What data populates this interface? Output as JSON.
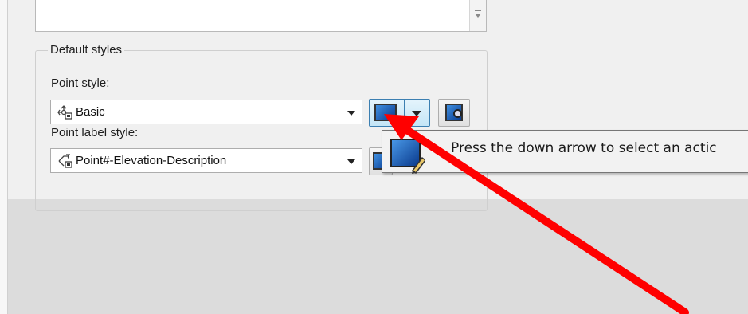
{
  "group": {
    "title": "Default styles"
  },
  "point_style": {
    "label": "Point style:",
    "value": "Basic"
  },
  "point_label_style": {
    "label": "Point label style:",
    "value": "Point#-Elevation-Description"
  },
  "tooltip": {
    "text": "Press the down arrow to select an actic"
  },
  "colors": {
    "accent": "#3c7fb1",
    "arrow": "#ff0000"
  },
  "icons": {
    "point_style": "point-style-icon",
    "point_label_style": "point-label-style-icon",
    "edit_style": "edit-style-icon",
    "preview": "preview-icon"
  }
}
